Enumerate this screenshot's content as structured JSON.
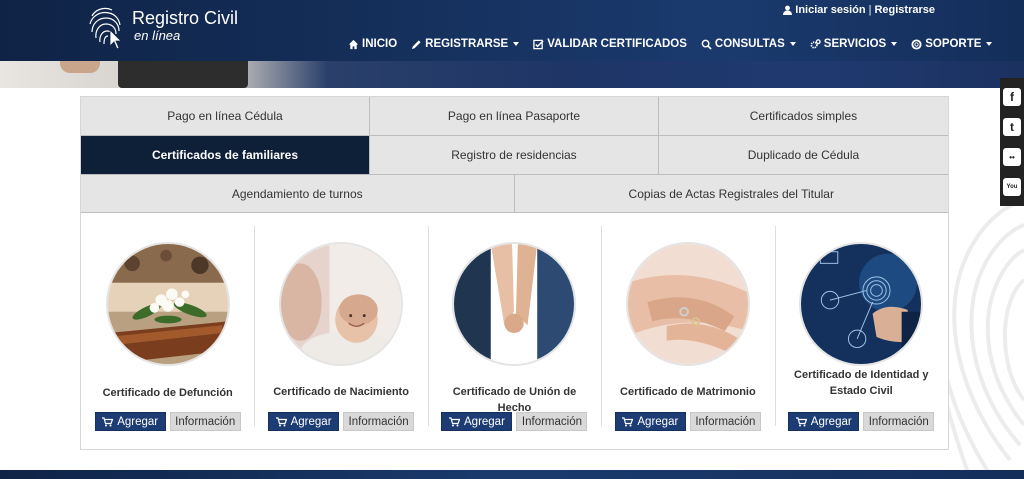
{
  "brand": {
    "title": "Registro Civil",
    "subtitle": "en línea",
    "colors": {
      "header": "#15305c",
      "active_tab": "#0e1f38",
      "add_button": "#1d3c73",
      "info_button": "#d9d9d9"
    }
  },
  "top_links": {
    "login": "Iniciar sesión",
    "separator": "|",
    "register": "Registrarse"
  },
  "nav": {
    "items": [
      {
        "label": "INICIO",
        "icon": "home-icon"
      },
      {
        "label": "REGISTRARSE",
        "icon": "pencil-icon",
        "dropdown": true
      },
      {
        "label": "VALIDAR CERTIFICADOS",
        "icon": "check-square-icon"
      },
      {
        "label": "CONSULTAS",
        "icon": "search-icon",
        "dropdown": true
      },
      {
        "label": "SERVICIOS",
        "icon": "gears-icon",
        "dropdown": true
      },
      {
        "label": "SOPORTE",
        "icon": "lifebuoy-icon",
        "dropdown": true
      }
    ]
  },
  "tabs": {
    "row1": [
      "Pago en línea Cédula",
      "Pago en línea Pasaporte",
      "Certificados simples"
    ],
    "row2": [
      "Certificados de familiares",
      "Registro de residencias",
      "Duplicado de Cédula"
    ],
    "row3": [
      "Agendamiento de turnos",
      "Copias de Actas Registrales del Titular"
    ],
    "active": "Certificados de familiares"
  },
  "cards": [
    {
      "title": "Certificado de Defunción",
      "image": "funeral-flowers-image",
      "add_label": "Agregar",
      "info_label": "Información"
    },
    {
      "title": "Certificado de Nacimiento",
      "image": "newborn-baby-image",
      "add_label": "Agregar",
      "info_label": "Información"
    },
    {
      "title": "Certificado de Unión de Hecho",
      "image": "holding-hands-image",
      "add_label": "Agregar",
      "info_label": "Información"
    },
    {
      "title": "Certificado de Matrimonio",
      "image": "wedding-rings-hands-image",
      "add_label": "Agregar",
      "info_label": "Información"
    },
    {
      "title": "Certificado de Identidad y Estado Civil",
      "image": "fingerprint-identity-image",
      "add_label": "Agregar",
      "info_label": "Información"
    }
  ],
  "social": [
    "facebook-icon",
    "twitter-icon",
    "flickr-icon",
    "youtube-icon"
  ],
  "social_labels": {
    "facebook": "f",
    "twitter": "t",
    "flickr": "••",
    "youtube": "You"
  }
}
